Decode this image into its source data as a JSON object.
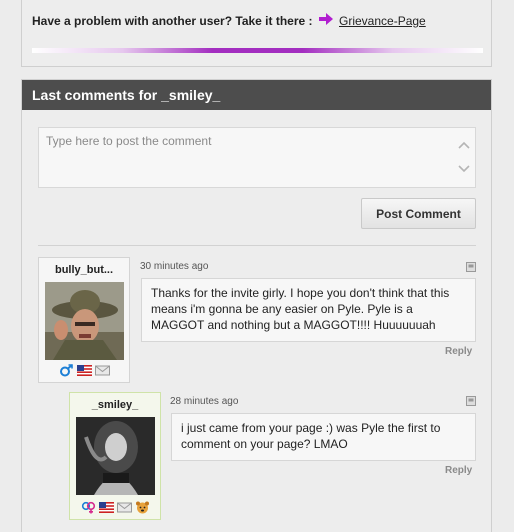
{
  "notice": {
    "text": "Have a problem with another user? Take it there :",
    "link_label": "Grievance-Page",
    "arrow_icon": "arrow-right-icon",
    "divider_color": "#a32ec0"
  },
  "comments_section": {
    "title": "Last comments for _smiley_",
    "input_placeholder": "Type here to post the comment",
    "input_value": "",
    "post_button_label": "Post Comment",
    "header_color": "#4d4d4d"
  },
  "comments": [
    {
      "username": "bully_but...",
      "time": "30 minutes ago",
      "text": "Thanks for the invite girly. I hope you don't think that this means i'm gonna be any easier on Pyle. Pyle is a MAGGOT and nothing but a MAGGOT!!!! Huuuuuuah",
      "reply_label": "Reply",
      "icons": [
        "male-gender-icon",
        "us-flag-icon",
        "message-envelope-icon"
      ]
    },
    {
      "username": "_smiley_",
      "time": "28 minutes ago",
      "text": "i just came from your page :) was Pyle the first to comment on your page? LMAO",
      "reply_label": "Reply",
      "icons": [
        "couple-gender-icon",
        "us-flag-icon",
        "message-envelope-icon",
        "badge-animal-icon"
      ]
    }
  ]
}
